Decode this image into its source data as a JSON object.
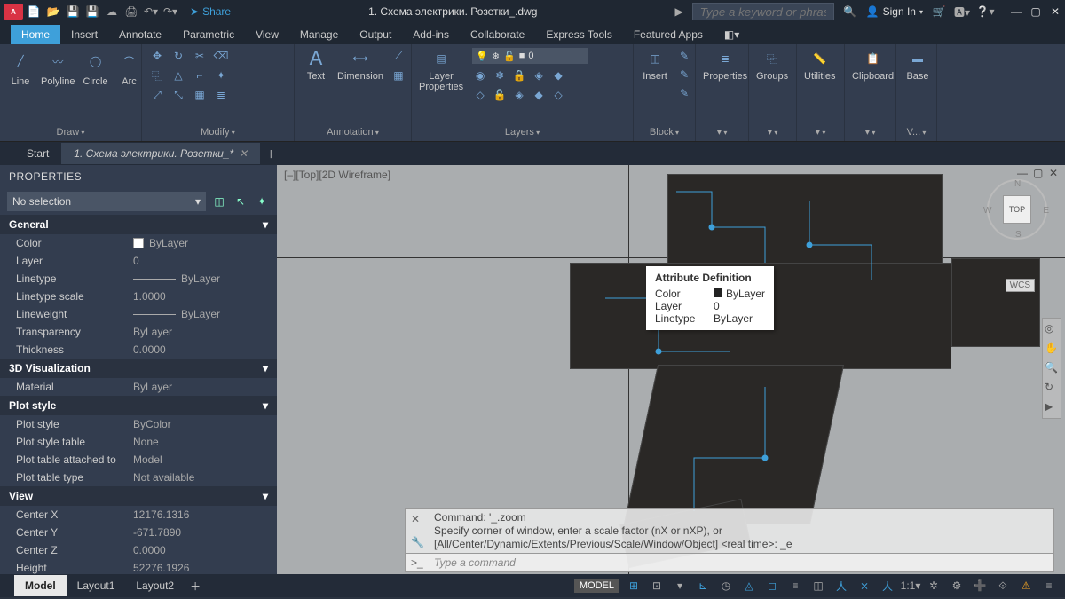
{
  "app": {
    "logo_text": "A CAD",
    "doc_title": "1. Схема электрики. Розетки_.dwg",
    "share": "Share",
    "search_placeholder": "Type a keyword or phrase",
    "sign_in": "Sign In"
  },
  "ribbon_tabs": [
    "Home",
    "Insert",
    "Annotate",
    "Parametric",
    "View",
    "Manage",
    "Output",
    "Add-ins",
    "Collaborate",
    "Express Tools",
    "Featured Apps"
  ],
  "ribbon": {
    "draw": {
      "label": "Draw",
      "items": [
        "Line",
        "Polyline",
        "Circle",
        "Arc"
      ]
    },
    "modify": {
      "label": "Modify"
    },
    "annotation": {
      "label": "Annotation",
      "text": "Text",
      "dim": "Dimension"
    },
    "layers": {
      "label": "Layers",
      "layer_props": "Layer\nProperties",
      "current": "0"
    },
    "block": {
      "label": "Block",
      "insert": "Insert"
    },
    "properties": {
      "label": "Properties"
    },
    "groups": {
      "label": "Groups"
    },
    "utilities": {
      "label": "Utilities"
    },
    "clipboard": {
      "label": "Clipboard"
    },
    "view": {
      "label": "V...",
      "base": "Base"
    }
  },
  "doc_tabs": {
    "start": "Start",
    "file": "1. Схема электрики. Розетки_*"
  },
  "properties": {
    "title": "PROPERTIES",
    "selection": "No selection",
    "sections": {
      "general": {
        "title": "General",
        "rows": [
          {
            "k": "Color",
            "v": "ByLayer",
            "swatch": true
          },
          {
            "k": "Layer",
            "v": "0"
          },
          {
            "k": "Linetype",
            "v": "ByLayer",
            "line": true
          },
          {
            "k": "Linetype scale",
            "v": "1.0000"
          },
          {
            "k": "Lineweight",
            "v": "ByLayer",
            "line": true
          },
          {
            "k": "Transparency",
            "v": "ByLayer"
          },
          {
            "k": "Thickness",
            "v": "0.0000"
          }
        ]
      },
      "viz": {
        "title": "3D Visualization",
        "rows": [
          {
            "k": "Material",
            "v": "ByLayer"
          }
        ]
      },
      "plot": {
        "title": "Plot style",
        "rows": [
          {
            "k": "Plot style",
            "v": "ByColor"
          },
          {
            "k": "Plot style table",
            "v": "None"
          },
          {
            "k": "Plot table attached to",
            "v": "Model"
          },
          {
            "k": "Plot table type",
            "v": "Not available"
          }
        ]
      },
      "view": {
        "title": "View",
        "rows": [
          {
            "k": "Center X",
            "v": "12176.1316"
          },
          {
            "k": "Center Y",
            "v": "-671.7890"
          },
          {
            "k": "Center Z",
            "v": "0.0000"
          },
          {
            "k": "Height",
            "v": "52276.1926"
          }
        ]
      }
    }
  },
  "viewport": {
    "label": "[–][Top][2D Wireframe]",
    "cube": {
      "face": "TOP",
      "n": "N",
      "s": "S",
      "e": "E",
      "w": "W",
      "wcs": "WCS"
    }
  },
  "tooltip": {
    "title": "Attribute Definition",
    "rows": [
      {
        "k": "Color",
        "v": "ByLayer",
        "swatch": true
      },
      {
        "k": "Layer",
        "v": "0"
      },
      {
        "k": "Linetype",
        "v": "ByLayer"
      }
    ]
  },
  "cmd": {
    "hist1": "Command: '_.zoom",
    "hist2": "Specify corner of window, enter a scale factor (nX or nXP), or",
    "hist3": "[All/Center/Dynamic/Extents/Previous/Scale/Window/Object] <real time>: _e",
    "prompt": ">_",
    "placeholder": "Type a command"
  },
  "layout_tabs": [
    "Model",
    "Layout1",
    "Layout2"
  ],
  "status": {
    "model": "MODEL",
    "scale": "1:1"
  }
}
